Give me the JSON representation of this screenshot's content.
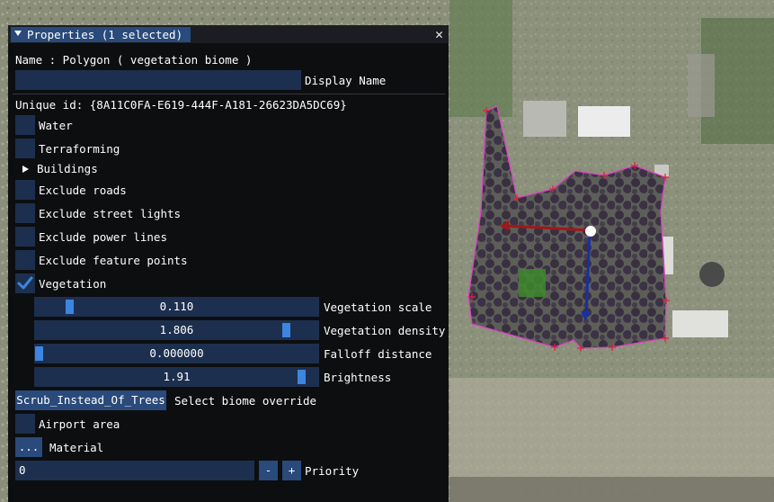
{
  "panel": {
    "title": "Properties (1 selected)",
    "close_glyph": "✕",
    "name_line": "Name : Polygon  ( vegetation biome )",
    "display_name": {
      "value": "",
      "label": "Display Name"
    },
    "unique_id": "Unique id: {8A11C0FA-E619-444F-A181-26623DA5DC69}",
    "checkboxes": {
      "water": {
        "label": "Water",
        "checked": false
      },
      "terraforming": {
        "label": "Terraforming",
        "checked": false
      },
      "exclude_roads": {
        "label": "Exclude roads",
        "checked": false
      },
      "exclude_street_lights": {
        "label": "Exclude street lights",
        "checked": false
      },
      "exclude_power_lines": {
        "label": "Exclude power lines",
        "checked": false
      },
      "exclude_feature_points": {
        "label": "Exclude feature points",
        "checked": false
      },
      "vegetation": {
        "label": "Vegetation",
        "checked": true
      },
      "airport_area": {
        "label": "Airport area",
        "checked": false
      }
    },
    "buildings": {
      "label": "Buildings",
      "expanded": false
    },
    "sliders": {
      "vegetation_scale": {
        "value": "0.110",
        "label": "Vegetation scale",
        "fill": 0.11
      },
      "vegetation_density": {
        "value": "1.806",
        "label": "Vegetation density",
        "fill": 0.9
      },
      "falloff_distance": {
        "value": "0.000000",
        "label": "Falloff distance",
        "fill": 0.0
      },
      "brightness": {
        "value": "1.91",
        "label": "Brightness",
        "fill": 0.955
      }
    },
    "biome_override": {
      "button_label": "Scrub_Instead_Of_Trees",
      "label": "Select biome override"
    },
    "material": {
      "button_label": "...",
      "label": "Material"
    },
    "priority": {
      "value": "0",
      "minus": "-",
      "plus": "+",
      "label": "Priority"
    }
  },
  "colors": {
    "panel_bg": "#0d0e10",
    "frame_bg": "#1d2f4e",
    "accent": "#3d85e0",
    "tab_active": "#294a7a",
    "polygon_outline": "#e040c8"
  },
  "icons": {
    "collapse": "triangle-down-icon",
    "close": "close-icon",
    "check": "check-icon",
    "expand": "triangle-right-icon"
  }
}
